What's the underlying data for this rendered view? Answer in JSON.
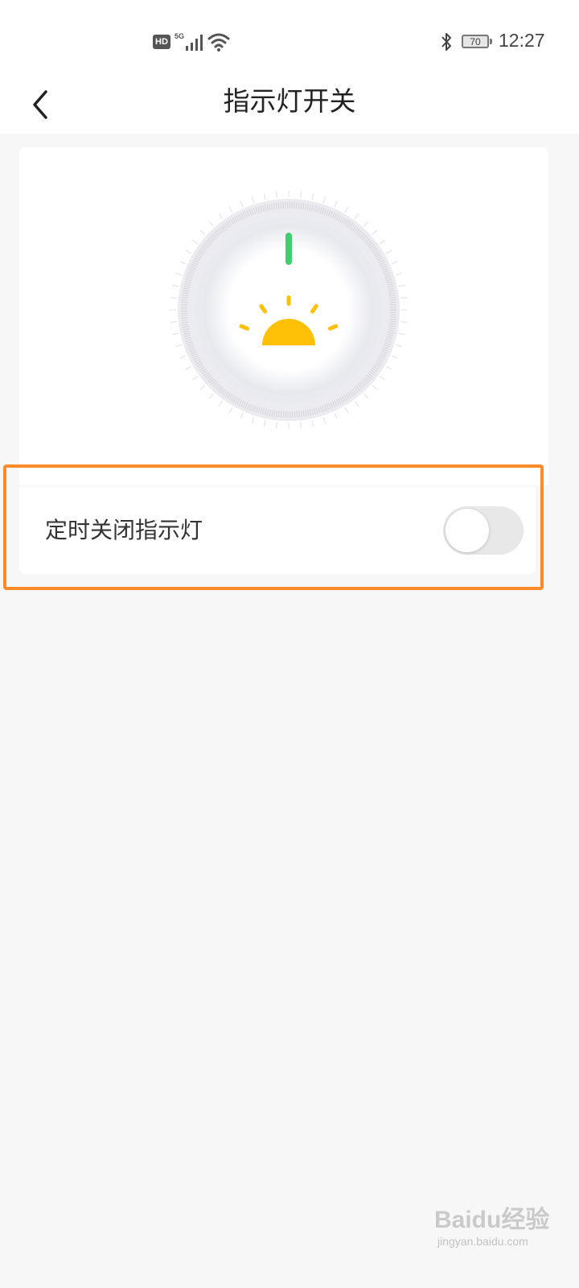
{
  "status_bar": {
    "hd_label": "HD",
    "network_label": "5G",
    "battery_level": "70",
    "time": "12:27",
    "icons": [
      "signal-icon",
      "wifi-icon",
      "bluetooth-icon",
      "battery-icon"
    ]
  },
  "header": {
    "title": "指示灯开关",
    "back_icon": "chevron-left-icon"
  },
  "dial": {
    "indicator_on": true,
    "indicator_color": "#3ecf6e",
    "sun_color": "#ffc107",
    "icon": "sun-icon"
  },
  "setting": {
    "label": "定时关闭指示灯",
    "enabled": false
  },
  "colors": {
    "background": "#f7f7f7",
    "card": "#ffffff",
    "highlight": "#ff8a2a",
    "toggle_off": "#e8e8e8"
  },
  "watermark": {
    "brand": "Baidu经验",
    "sub": "jingyan.baidu.com"
  }
}
